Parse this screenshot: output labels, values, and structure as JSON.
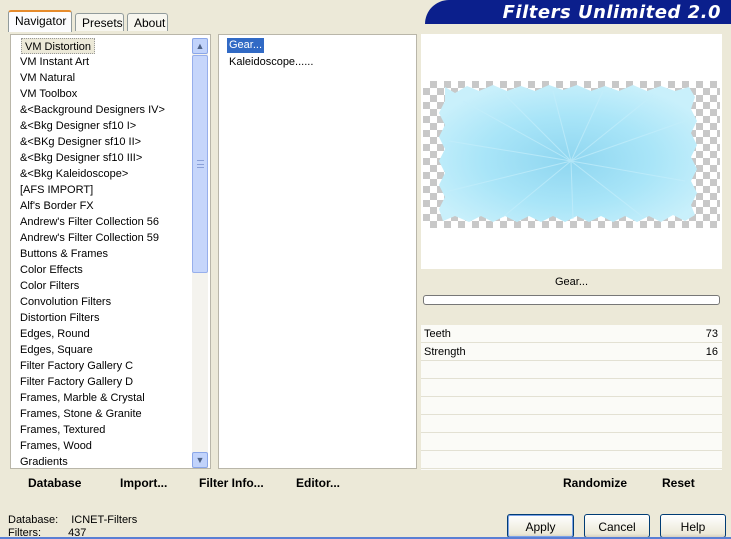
{
  "tabs": [
    {
      "label": "Navigator",
      "active": true
    },
    {
      "label": "Presets",
      "active": false
    },
    {
      "label": "About",
      "active": false
    }
  ],
  "banner": {
    "title": "Filters Unlimited 2.0"
  },
  "categories": [
    "VM Distortion",
    "VM Instant Art",
    "VM Natural",
    "VM Toolbox",
    "&<Background Designers IV>",
    "&<Bkg Designer sf10 I>",
    "&<BKg Designer sf10 II>",
    "&<Bkg Designer sf10 III>",
    "&<Bkg Kaleidoscope>",
    "[AFS IMPORT]",
    "Alf's Border FX",
    "Andrew's Filter Collection 56",
    "Andrew's Filter Collection 59",
    "Buttons & Frames",
    "Color Effects",
    "Color Filters",
    "Convolution Filters",
    "Distortion Filters",
    "Edges, Round",
    "Edges, Square",
    "Filter Factory Gallery C",
    "Filter Factory Gallery D",
    "Frames, Marble & Crystal",
    "Frames, Stone & Granite",
    "Frames, Textured",
    "Frames, Wood",
    "Gradients"
  ],
  "selected_category": "VM Distortion",
  "filters": [
    "Gear...",
    "Kaleidoscope......"
  ],
  "selected_filter": "Gear...",
  "preview": {
    "filter_name": "Gear...",
    "progress": 0
  },
  "params": [
    {
      "label": "Teeth",
      "value": "73"
    },
    {
      "label": "Strength",
      "value": "16"
    }
  ],
  "bottom_left": {
    "database": "Database",
    "import": "Import...",
    "filter_info": "Filter Info...",
    "editor": "Editor..."
  },
  "bottom_right": {
    "randomize": "Randomize",
    "reset": "Reset"
  },
  "buttons": {
    "apply": "Apply",
    "cancel": "Cancel",
    "help": "Help"
  },
  "status": {
    "database_label": "Database:",
    "database_value": "ICNET-Filters",
    "filters_label": "Filters:",
    "filters_value": "437"
  },
  "colors": {
    "banner": "#0b1f8c",
    "preview_fill": "#a6e3f6",
    "selection": "#316ac5"
  }
}
